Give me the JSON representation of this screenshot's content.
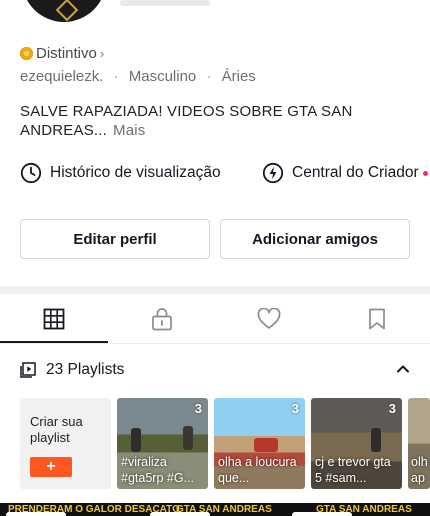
{
  "profile": {
    "badge_label": "Distintivo",
    "badge_chevron": "›",
    "username": "ezequielezk.",
    "gender": "Masculino",
    "zodiac": "Áries",
    "separator": "·",
    "bio": "SALVE RAPAZIADA! VIDEOS SOBRE GTA SAN ANDREAS...",
    "bio_more": "Mais"
  },
  "links": {
    "history_label": "Histórico de visualização",
    "creator_label": "Central do Criador"
  },
  "buttons": {
    "edit_profile": "Editar perfil",
    "add_friends": "Adicionar amigos"
  },
  "tabs": [
    {
      "name": "grid",
      "icon": "grid-icon",
      "active": true
    },
    {
      "name": "private",
      "icon": "lock-icon",
      "active": false
    },
    {
      "name": "liked",
      "icon": "heart-icon",
      "active": false
    },
    {
      "name": "saved",
      "icon": "bookmark-icon",
      "active": false
    }
  ],
  "playlists": {
    "header": "23 Playlists",
    "create_label": "Criar sua playlist",
    "create_button": "+",
    "items": [
      {
        "count": "3",
        "caption": "#viraliza #gta5rp #G..."
      },
      {
        "count": "3",
        "caption": "olha a loucura que..."
      },
      {
        "count": "3",
        "caption": "cj e trevor gta 5 #sam..."
      },
      {
        "count": "",
        "caption": "olh ap"
      }
    ]
  },
  "bottom_strip": {
    "texts": [
      "PRENDERAM O GALOR DESACATO",
      "GTA SAN ANDREAS",
      "GTA SAN ANDREAS"
    ]
  },
  "colors": {
    "accent": "#fe2c55",
    "create_button": "#fe5722",
    "badge": "#f3a712"
  }
}
